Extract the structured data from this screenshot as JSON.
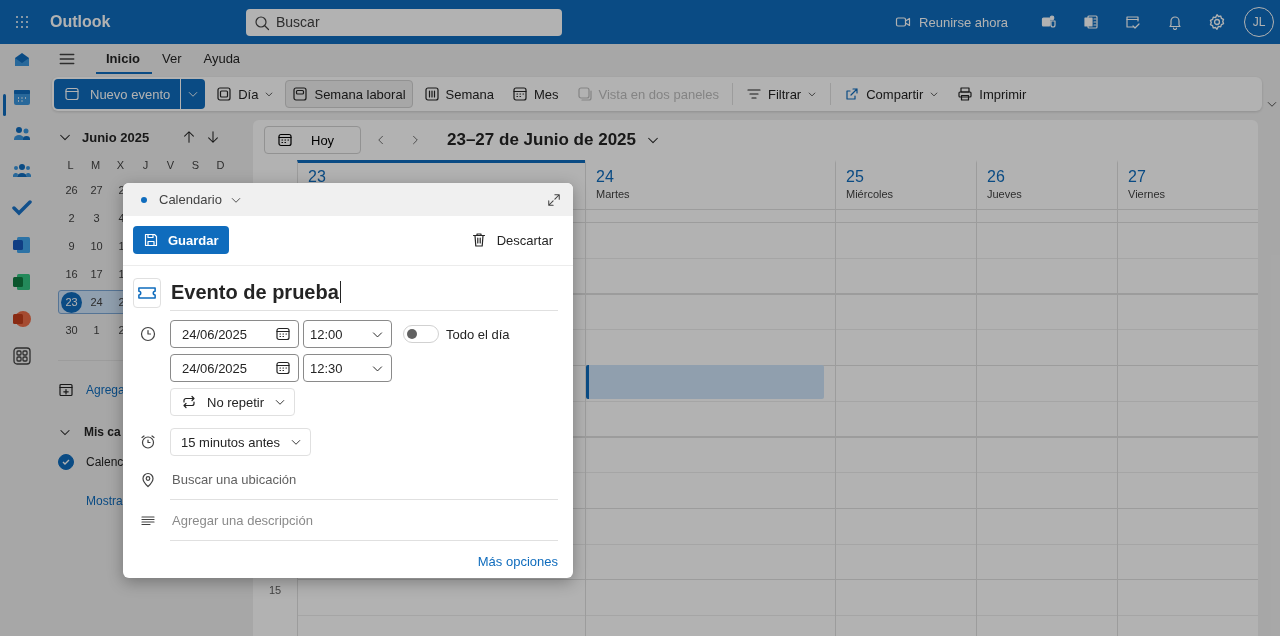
{
  "app_title": "Outlook",
  "search": {
    "placeholder": "Buscar"
  },
  "header": {
    "meet_now": "Reunirse ahora",
    "avatar": "JL"
  },
  "tabs": [
    {
      "label": "Inicio",
      "selected": true
    },
    {
      "label": "Ver",
      "selected": false
    },
    {
      "label": "Ayuda",
      "selected": false
    }
  ],
  "ribbon": {
    "new_event": "Nuevo evento",
    "views": [
      {
        "label": "Día",
        "menu": true,
        "selected": false,
        "disabled": false
      },
      {
        "label": "Semana laboral",
        "menu": false,
        "selected": true,
        "disabled": false
      },
      {
        "label": "Semana",
        "menu": false,
        "selected": false,
        "disabled": false
      },
      {
        "label": "Mes",
        "menu": false,
        "selected": false,
        "disabled": false
      },
      {
        "label": "Vista en dos paneles",
        "menu": false,
        "selected": false,
        "disabled": true
      }
    ],
    "filter": {
      "label": "Filtrar",
      "menu": true
    },
    "actions": [
      {
        "label": "Compartir",
        "menu": true
      },
      {
        "label": "Imprimir",
        "menu": false
      }
    ]
  },
  "mini_calendar": {
    "month": "Junio 2025",
    "weekdays": [
      "L",
      "M",
      "X",
      "J",
      "V",
      "S",
      "D"
    ],
    "weeks": [
      {
        "selected": false,
        "days": [
          {
            "label": "26",
            "today": false
          },
          {
            "label": "27",
            "today": false
          },
          {
            "label": "2",
            "today": false
          }
        ]
      },
      {
        "selected": false,
        "days": [
          {
            "label": "2",
            "today": false
          },
          {
            "label": "3",
            "today": false
          },
          {
            "label": "4",
            "today": false
          }
        ]
      },
      {
        "selected": false,
        "days": [
          {
            "label": "9",
            "today": false
          },
          {
            "label": "10",
            "today": false
          },
          {
            "label": "1",
            "today": false
          }
        ]
      },
      {
        "selected": false,
        "days": [
          {
            "label": "16",
            "today": false
          },
          {
            "label": "17",
            "today": false
          },
          {
            "label": "1",
            "today": false
          }
        ]
      },
      {
        "selected": true,
        "days": [
          {
            "label": "23",
            "today": true
          },
          {
            "label": "24",
            "today": false
          },
          {
            "label": "2",
            "today": false
          }
        ]
      },
      {
        "selected": false,
        "days": [
          {
            "label": "30",
            "today": false
          },
          {
            "label": "1",
            "today": false
          },
          {
            "label": "2",
            "today": false
          }
        ]
      }
    ]
  },
  "add_calendar": "Agrega",
  "my_calendars": {
    "title": "Mis ca",
    "expanded": true,
    "items": [
      {
        "label": "Calenc",
        "checked": true
      }
    ]
  },
  "show_more": "Mostra",
  "calendar": {
    "today_button": "Hoy",
    "range": "23–27 de Junio de 2025",
    "days": [
      {
        "number": "23",
        "selected": true
      },
      {
        "number": "24",
        "name": "Martes",
        "selected": false
      },
      {
        "number": "25",
        "name": "Miércoles",
        "selected": false
      },
      {
        "number": "26",
        "name": "Jueves",
        "selected": false
      },
      {
        "number": "27",
        "name": "Viernes",
        "selected": false
      }
    ],
    "hour_label": "15"
  },
  "popup": {
    "calendar": "Calendario",
    "save": "Guardar",
    "discard": "Descartar",
    "title": "Evento de prueba",
    "start_date": "24/06/2025",
    "start_time": "12:00",
    "end_date": "24/06/2025",
    "end_time": "12:30",
    "all_day": {
      "label": "Todo el día",
      "on": false
    },
    "repeat": "No repetir",
    "reminder": "15 minutos antes",
    "location": {
      "placeholder": "Buscar una ubicación"
    },
    "description": {
      "placeholder": "Agregar una descripción"
    },
    "more_options": "Más opciones"
  }
}
